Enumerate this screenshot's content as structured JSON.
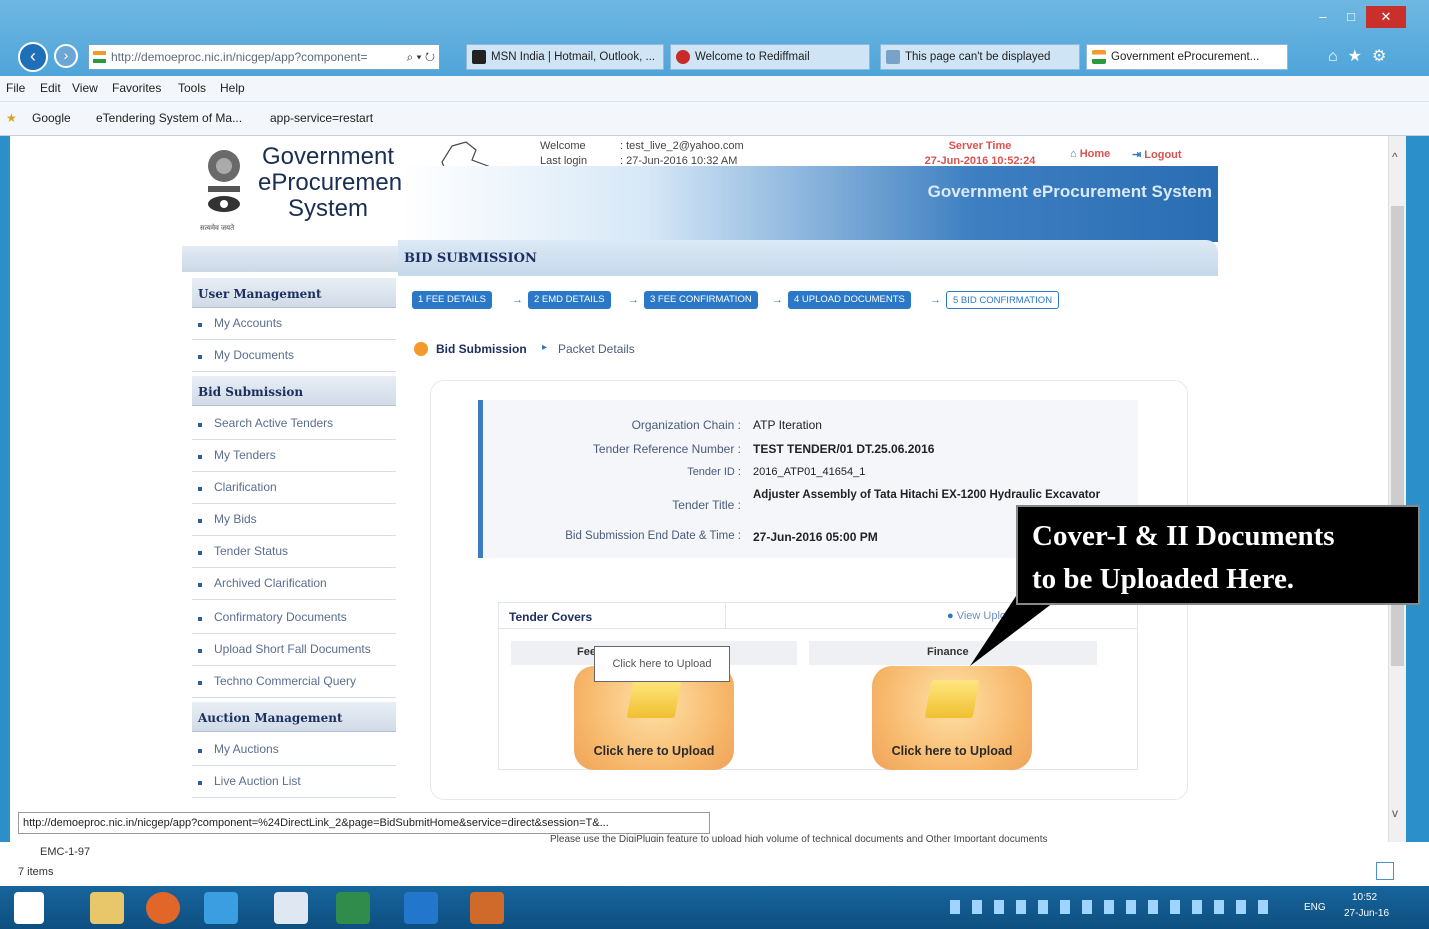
{
  "browser": {
    "address": "http://demoeproc.nic.in/nicgep/app?component=",
    "address_search": "⌕ ▾ ↻",
    "tabs": [
      {
        "label": "MSN India | Hotmail, Outlook, ..."
      },
      {
        "label": "Welcome to Rediffmail"
      },
      {
        "label": "This page can't be displayed"
      },
      {
        "label": "Government eProcurement..."
      }
    ],
    "menu": [
      "File",
      "Edit",
      "View",
      "Favorites",
      "Tools",
      "Help"
    ],
    "favorites": [
      "Google",
      "eTendering System of Ma...",
      "app-service=restart"
    ],
    "status_url": "http://demoeproc.nic.in/nicgep/app?component=%24DirectLink_2&page=BidSubmitHome&service=direct&session=T&...",
    "items_count": "7 items",
    "folder_label": "EMC-1-97"
  },
  "site": {
    "logo_text": "Government eProcurement System",
    "welcome_label": "Welcome",
    "welcome_value": ": test_live_2@yahoo.com",
    "lastlogin_label": "Last login",
    "lastlogin_value": ": 27-Jun-2016 10:32 AM",
    "server_time_label": "Server Time",
    "server_time_value": "27-Jun-2016 10:52:24",
    "home": "Home",
    "logout": "Logout",
    "system_title": "Government eProcurement System",
    "emblem_caption": "सत्यमेव जयते"
  },
  "nav": {
    "user_mgmt": "User Management",
    "user_items": [
      "My Accounts",
      "My Documents"
    ],
    "bid_sub": "Bid Submission",
    "bid_items": [
      "Search Active Tenders",
      "My Tenders",
      "Clarification",
      "My Bids",
      "Tender Status",
      "Archived Clarification",
      "Confirmatory Documents",
      "Upload Short Fall Documents",
      "Techno Commercial Query"
    ],
    "auction_mgmt": "Auction Management",
    "auction_items": [
      "My Auctions",
      "Live Auction List"
    ]
  },
  "main": {
    "section_title": "BID SUBMISSION",
    "steps": [
      "1  FEE DETAILS",
      "2  EMD DETAILS",
      "3  FEE CONFIRMATION",
      "4  UPLOAD DOCUMENTS",
      "5  BID CONFIRMATION"
    ],
    "breadcrumb_1": "Bid Submission",
    "breadcrumb_sep": "▸",
    "breadcrumb_2": "Packet Details",
    "details": {
      "org_label": "Organization Chain :",
      "org_value": "ATP Iteration",
      "ref_label": "Tender Reference Number :",
      "ref_value": "TEST TENDER/01 DT.25.06.2016",
      "id_label": "Tender ID :",
      "id_value": "2016_ATP01_41654_1",
      "title_label": "Tender Title :",
      "title_value": "Adjuster Assembly of Tata Hitachi EX-1200 Hydraulic Excavator",
      "end_label": "Bid Submission End Date & Time :",
      "end_value": "27-Jun-2016 05:00 PM"
    },
    "covers_label": "Tender Covers",
    "view_uploaded": "View Uploaded",
    "cover1_head": "Fee",
    "cover2_head": "Finance",
    "upload_label": "Click here to Upload",
    "tooltip": "Click here to Upload",
    "footer_note": "Please use the DigiPlugin feature to upload high volume of technical documents and Other Important documents"
  },
  "callout": {
    "line1": "Cover-I & II Documents",
    "line2": "to be Uploaded Here."
  },
  "taskbar": {
    "time": "10:52",
    "date": "27-Jun-16",
    "lang": "ENG"
  },
  "colors": {
    "accent": "#2a78c7",
    "navy": "#1b2f60",
    "upload": "#f6b568"
  }
}
